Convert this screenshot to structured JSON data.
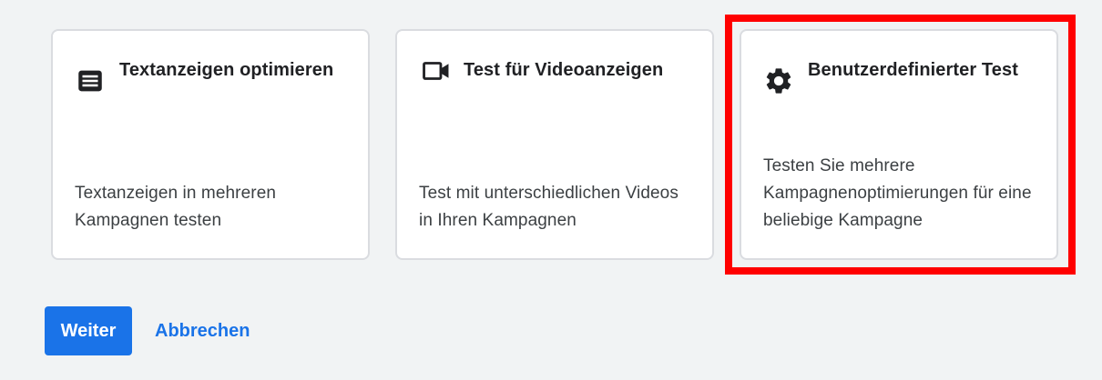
{
  "cards": [
    {
      "icon": "text-ad-icon",
      "title": "Textanzeigen optimieren",
      "description": "Textanzeigen in mehreren Kampagnen testen"
    },
    {
      "icon": "videocam-icon",
      "title": "Test für Videoanzeigen",
      "description": "Test mit unterschiedlichen Videos in Ihren Kampagnen"
    },
    {
      "icon": "gear-icon",
      "title": "Benutzerdefinierter Test",
      "description": "Testen Sie mehrere Kampagnenoptimierungen für eine beliebige Kampagne"
    }
  ],
  "actions": {
    "continue_label": "Weiter",
    "cancel_label": "Abbrechen"
  },
  "colors": {
    "background": "#f1f3f4",
    "primary": "#1a73e8",
    "highlight": "#ff0000",
    "card_border": "#dadce0"
  }
}
